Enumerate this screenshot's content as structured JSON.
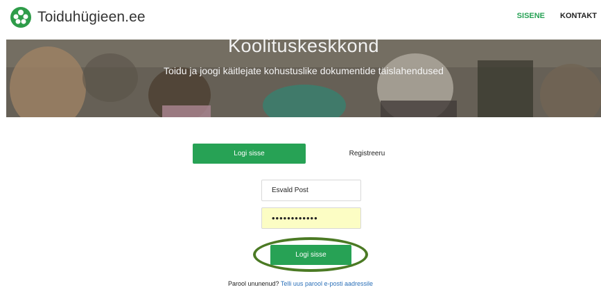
{
  "header": {
    "logo_text": "Toiduhügieen.ee",
    "nav": {
      "sisene": "SISENE",
      "kontakt": "KONTAKT"
    }
  },
  "hero": {
    "title": "Koolituskeskkond",
    "subtitle": "Toidu ja joogi käitlejate kohustuslike dokumentide täislahendused"
  },
  "tabs": {
    "login": "Logi sisse",
    "register": "Registreeru"
  },
  "form": {
    "username_value": "Esvald Post",
    "password_value": "••••••••••••",
    "submit_label": "Logi sisse"
  },
  "forgot": {
    "question": "Parool ununenud?",
    "link": "Telli uus parool e-posti aadressile"
  },
  "colors": {
    "accent": "#27a255",
    "highlight_ring": "#4b7a24",
    "link": "#2a6fb8"
  }
}
